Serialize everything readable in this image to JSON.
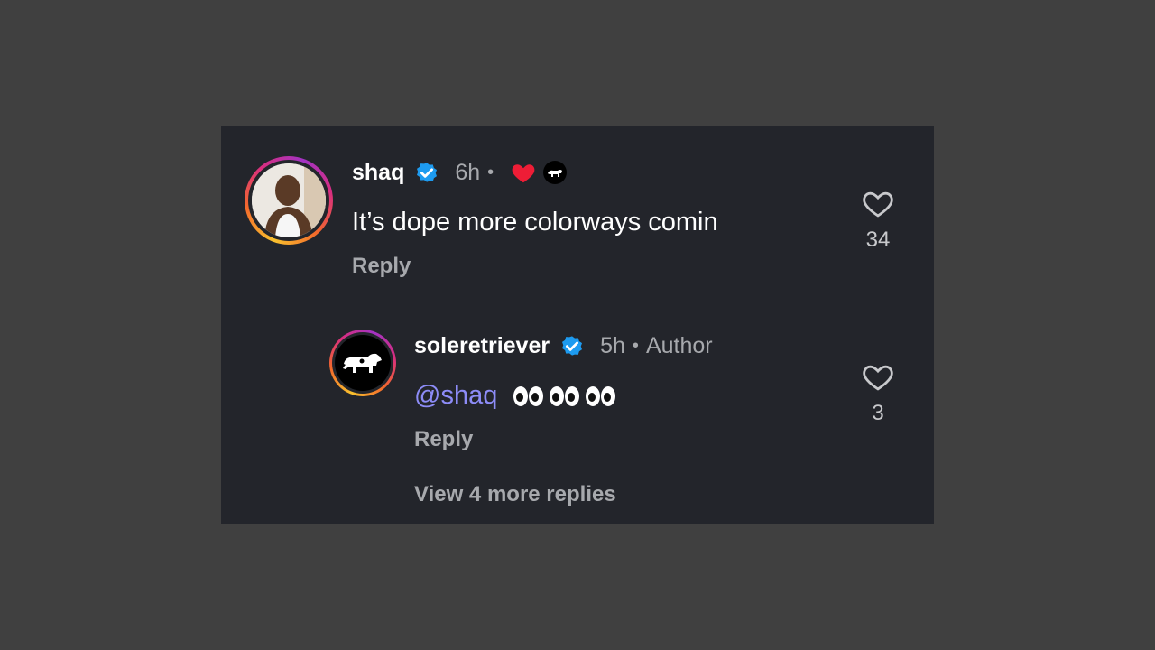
{
  "comments": [
    {
      "username": "shaq",
      "time": "6h",
      "reactions": [
        "heart-red",
        "creator-avatar"
      ],
      "text": "It’s dope more colorways comin",
      "reply_label": "Reply",
      "likes": "34"
    }
  ],
  "reply": {
    "username": "soleretriever",
    "time": "5h",
    "author_label": "Author",
    "mention": "@shaq",
    "emoji": "👀👀👀",
    "reply_label": "Reply",
    "likes": "3"
  },
  "view_more": "View 4 more replies",
  "colors": {
    "card_bg": "#23252b",
    "page_bg": "#404040",
    "verified": "#1d9bf0",
    "mention": "#8d8cf7",
    "heart": "#ee1d36"
  }
}
